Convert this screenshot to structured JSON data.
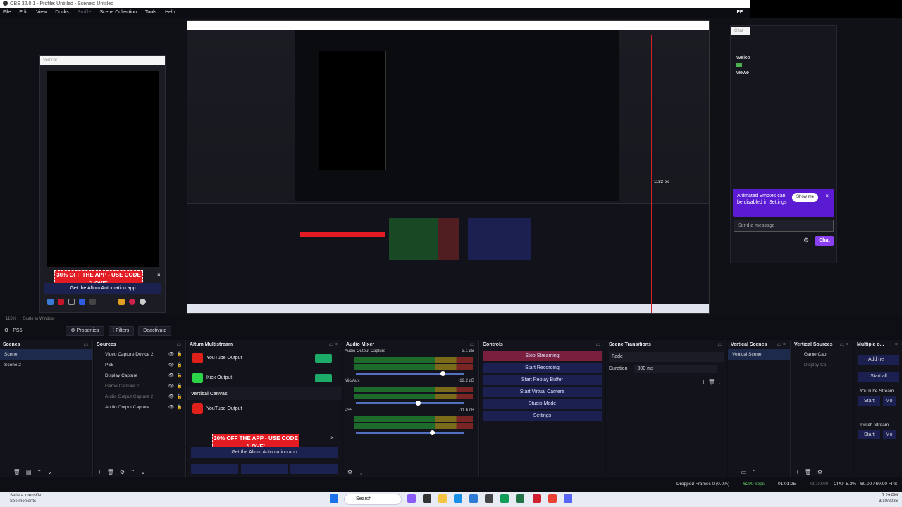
{
  "window": {
    "title": "OBS 32.0.1 - Profile: Untitled - Scenes: Untitled"
  },
  "menu": {
    "items": [
      "File",
      "Edit",
      "View",
      "Docks",
      "Profile",
      "Scene Collection",
      "Tools",
      "Help"
    ],
    "ff": "FF"
  },
  "preview": {
    "vertical_title": "Vertical",
    "promo": "30% OFF THE APP - USE CODE 'LOVE'",
    "get_app": "Get the Altum Automation app",
    "measure": "1183 px",
    "close": "×"
  },
  "chat": {
    "tab": "Chat",
    "welcome": [
      "Welco",
      "viewe"
    ],
    "popup": "Animated Emotes can be disabled in Settings",
    "show_me": "Show me",
    "placeholder": "Send a message",
    "chat_button": "Chat"
  },
  "zoom": {
    "level": "115%",
    "scale": "Scale to Window"
  },
  "source_bar": {
    "name": "PS5",
    "properties": "Properties",
    "filters": "Filters",
    "deactivate": "Deactivate"
  },
  "scenes": {
    "title": "Scenes",
    "items": [
      "Scene",
      "Scene 2"
    ]
  },
  "sources": {
    "title": "Sources",
    "items": [
      {
        "label": "Video Capture Device 2",
        "dim": false
      },
      {
        "label": "PS5",
        "dim": false
      },
      {
        "label": "Display Capture",
        "dim": false
      },
      {
        "label": "Game Capture 2",
        "dim": true
      },
      {
        "label": "Audio Output Capture 2",
        "dim": true
      },
      {
        "label": "Audio Output Capture",
        "dim": false
      }
    ]
  },
  "altum": {
    "title": "Altum Multistream",
    "outputs": [
      "YouTube Output",
      "Kick Output"
    ],
    "vertical_canvas": "Vertical Canvas",
    "vertical_output": "YouTube Output",
    "promo": "30% OFF THE APP - USE CODE 'LOVE'",
    "get_app": "Get the Altum Automation app"
  },
  "mixer": {
    "title": "Audio Mixer",
    "channels": [
      {
        "name": "Audio Output Capture",
        "db": "-3.1 dB",
        "level": 0.88
      },
      {
        "name": "Mic/Aux",
        "db": "-19.2 dB",
        "level": 0.6
      },
      {
        "name": "PS5",
        "db": "-11.6 dB",
        "level": 0.68
      }
    ],
    "scale": [
      "-60",
      "-55",
      "-50",
      "-45",
      "-40",
      "-35",
      "-30",
      "-25",
      "-20",
      "-15",
      "-10",
      "-5",
      "0"
    ]
  },
  "controls": {
    "title": "Controls",
    "buttons": [
      "Stop Streaming",
      "Start Recording",
      "Start Replay Buffer",
      "Start Virtual Camera",
      "Studio Mode",
      "Settings"
    ]
  },
  "transitions": {
    "title": "Scene Transitions",
    "type": "Fade",
    "duration_label": "Duration",
    "duration": "300 ms"
  },
  "vertical_scenes": {
    "title": "Vertical Scenes",
    "items": [
      "Vertical Scene"
    ]
  },
  "vertical_sources": {
    "title": "Vertical Sources",
    "items": [
      "Game Cap",
      "Display Ca"
    ]
  },
  "multiple": {
    "title": "Multiple o...",
    "add": "Add ne",
    "start_all": "Start all",
    "youtube": "YouTube Stream",
    "twitch": "Twitch Stream",
    "start": "Start",
    "more": "Mo"
  },
  "status": {
    "dropped": "Dropped Frames 0 (0.0%)",
    "kbps": "6290 kbps",
    "stream_time": "01:01:25",
    "rec_time": "00:00:00",
    "cpu": "CPU: 5.3%",
    "fps": "60.00 / 60.00 FPS"
  },
  "taskbar": {
    "search": "Search",
    "news_title": "Serie a intensifie",
    "news_sub": "See moments",
    "time": "7:29 PM",
    "date": "3/10/2026"
  }
}
